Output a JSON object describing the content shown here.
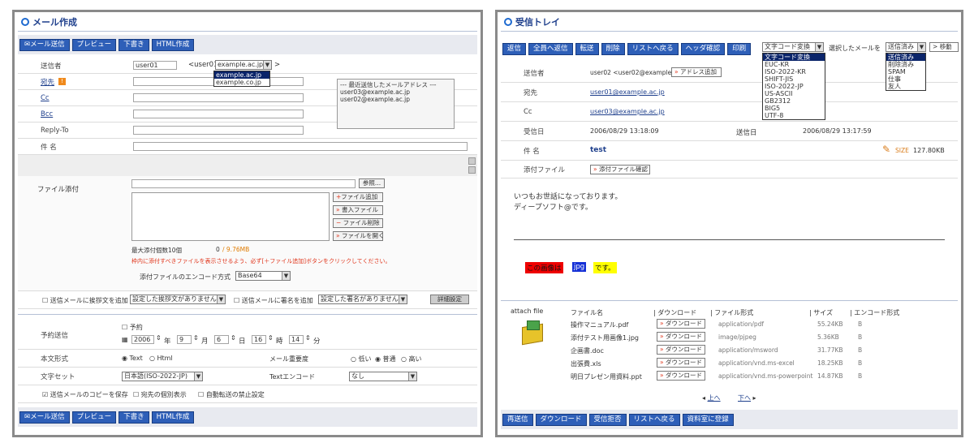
{
  "compose": {
    "title": "メール作成",
    "toolbar": [
      "メール送信",
      "プレビュー",
      "下書き",
      "HTML作成"
    ],
    "from_label": "送信者",
    "from_user": "user01",
    "from_prefix": "<user01@",
    "from_domain": "example.ac.jp",
    "from_suffix": ">",
    "domain_options": [
      "example.ac.jp",
      "example.co.jp"
    ],
    "to_label": "宛先",
    "cc_label": "Cc",
    "bcc_label": "Bcc",
    "replyto_label": "Reply-To",
    "subject_label": "件 名",
    "recent_title": "--- 最近送信したメールアドレス ---",
    "recent": [
      "user03@example.ac.jp",
      "user02@example.ac.jp"
    ],
    "attach_label": "ファイル添付",
    "browse": "参照...",
    "attach_buttons": [
      "ファイル追加",
      "書入ファイル",
      "ファイル削除",
      "ファイルを開く"
    ],
    "max_attach": "最大添付個数10個",
    "attach_count": "0",
    "attach_size": "/ 9.76MB",
    "attach_notice": "枠内に添付すべきファイルを表示させるよう、必ず[＋ファイル追加]ボタンをクリックしてください。",
    "encode_label": "添付ファイルのエンコード方式",
    "encode_value": "Base64",
    "greet_check": "送信メールに挨拶文を追加",
    "greet_select": "設定した挨拶文がありません。",
    "sign_check": "送信メールに署名を追加",
    "sign_select": "設定した署名がありません。",
    "detail_button": "詳細設定",
    "schedule_label": "予約送信",
    "schedule_check": "予約",
    "schedule": {
      "year": "2006",
      "year_unit": "年",
      "month": "9",
      "month_unit": "月",
      "day": "6",
      "day_unit": "日",
      "hour": "16",
      "hour_unit": "時",
      "min": "14",
      "min_unit": "分"
    },
    "body_format_label": "本文形式",
    "format_text": "Text",
    "format_html": "Html",
    "priority_label": "メール重要度",
    "priority_low": "低い",
    "priority_normal": "普通",
    "priority_high": "高い",
    "charset_label": "文字セット",
    "charset_value": "日本語(ISO-2022-JP)",
    "text_encode_label": "Textエンコード",
    "text_encode_value": "なし",
    "opt_copy": "送信メールのコピーを保存",
    "opt_each": "宛先の個別表示",
    "opt_forward": "自動転送の禁止設定"
  },
  "inbox": {
    "title": "受信トレイ",
    "toolbar": [
      "返信",
      "全員へ返信",
      "転送",
      "削除",
      "リストへ戻る",
      "ヘッダ確認",
      "印刷"
    ],
    "charset_select": "文字コード変換",
    "charset_options": [
      "文字コード変換",
      "EUC-KR",
      "ISO-2022-KR",
      "SHIFT-JIS",
      "ISO-2022-JP",
      "US-ASCII",
      "GB2312",
      "BIG5",
      "UTF-8"
    ],
    "move_label": "選択したメールを",
    "move_select": "送信済み",
    "move_options": [
      "送信済み",
      "削除済み",
      "SPAM",
      "仕事",
      "友人"
    ],
    "move_button": "移動",
    "from_label": "送信者",
    "from_value": "user02 <user02@example.ac.jp>",
    "add_address": "アドレス追加",
    "to_label": "宛先",
    "to_value": "user01@example.ac.jp",
    "cc_label": "Cc",
    "cc_value": "user03@example.ac.jp",
    "recv_label": "受信日",
    "recv_value": "2006/08/29 13:18:09",
    "sent_label": "送信日",
    "sent_value": "2006/08/29 13:17:59",
    "subject_label": "件 名",
    "subject_value": "test",
    "size_label": "SIZE",
    "size_value": "127.80KB",
    "attach_label": "添付ファイル",
    "attach_check": "添付ファイル確認",
    "body1": "いつもお世話になっております。",
    "body2": "ディープソフト@です。",
    "img_a": "この画像は",
    "img_b": "jpg",
    "img_c": "です。",
    "attach_file_label": "attach file",
    "cols": [
      "ファイル名",
      "ダウンロード",
      "ファイル形式",
      "サイズ",
      "エンコード形式"
    ],
    "files": [
      {
        "name": "操作マニュアル.pdf",
        "dl": "ダウンロード",
        "type": "application/pdf",
        "size": "55.24KB",
        "enc": "B"
      },
      {
        "name": "添付テスト用画像1.jpg",
        "dl": "ダウンロード",
        "type": "image/pjpeg",
        "size": "5.36KB",
        "enc": "B"
      },
      {
        "name": "企画書.doc",
        "dl": "ダウンロード",
        "type": "application/msword",
        "size": "31.77KB",
        "enc": "B"
      },
      {
        "name": "出張費.xls",
        "dl": "ダウンロード",
        "type": "application/vnd.ms-excel",
        "size": "18.25KB",
        "enc": "B"
      },
      {
        "name": "明日プレゼン用資料.ppt",
        "dl": "ダウンロード",
        "type": "application/vnd.ms-powerpoint",
        "size": "14.87KB",
        "enc": "B"
      }
    ],
    "prev": "上へ",
    "next": "下へ",
    "bottom": [
      "再送信",
      "ダウンロード",
      "受信拒否",
      "リストへ戻る",
      "資料室に登録"
    ]
  }
}
